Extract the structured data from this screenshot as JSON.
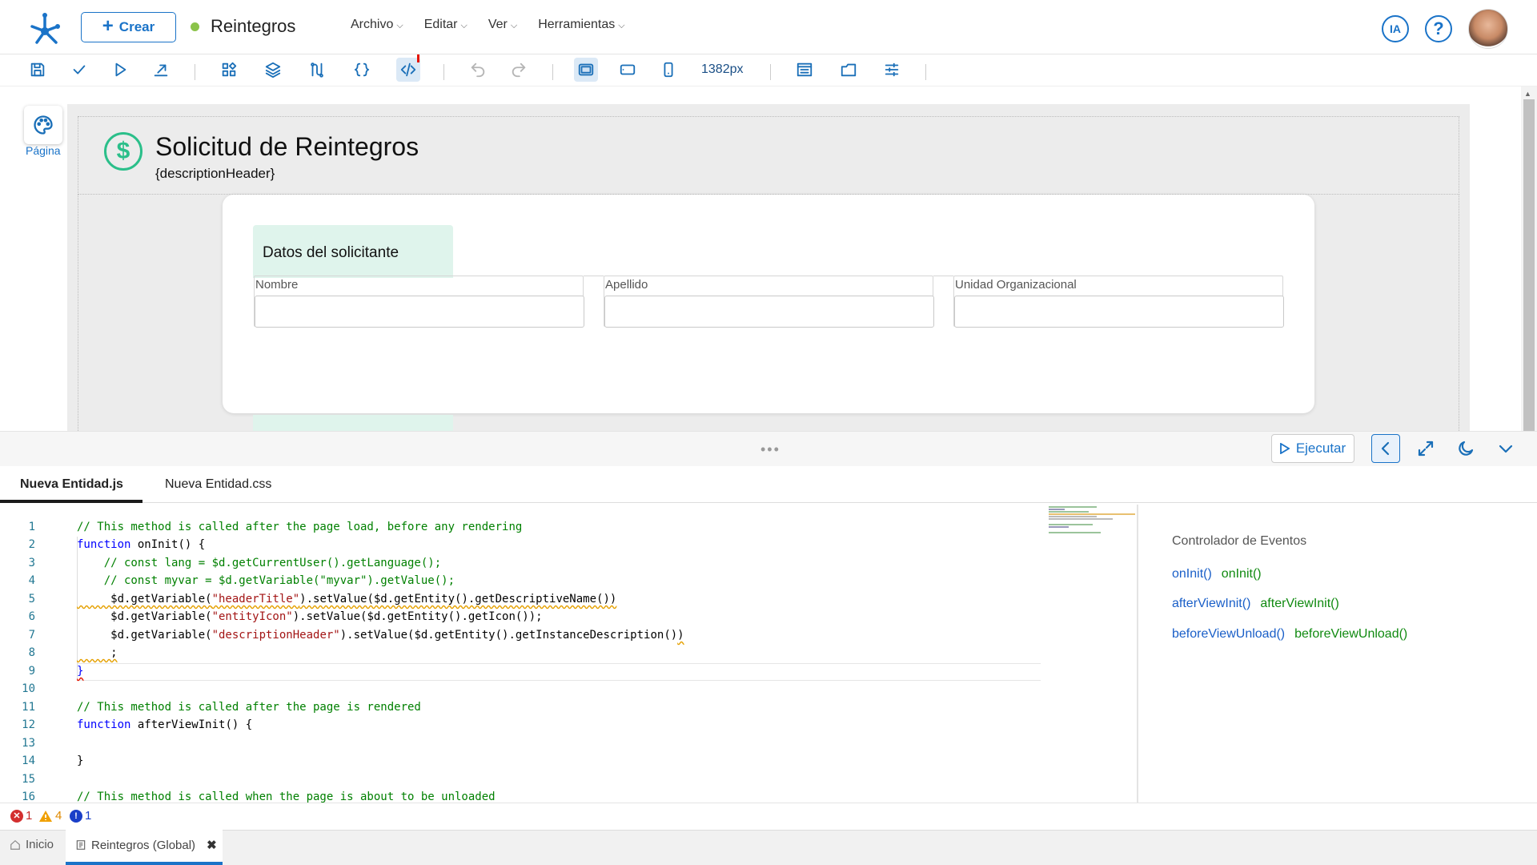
{
  "topbar": {
    "create_label": "Crear",
    "app_title": "Reintegros",
    "menu": [
      "Archivo",
      "Editar",
      "Ver",
      "Herramientas"
    ],
    "ia_label": "IA",
    "help_label": "?"
  },
  "toolbar": {
    "width_readout": "1382px"
  },
  "sidebar": {
    "page_label": "Página"
  },
  "form": {
    "title": "Solicitud de Reintegros",
    "description": "{descriptionHeader}",
    "section_title": "Datos del solicitante",
    "fields": [
      {
        "label": "Nombre",
        "value": ""
      },
      {
        "label": "Apellido",
        "value": ""
      },
      {
        "label": "Unidad Organizacional",
        "value": ""
      }
    ]
  },
  "editor": {
    "run_label": "Ejecutar",
    "drag_handle": "•••",
    "tabs": [
      "Nueva Entidad.js",
      "Nueva Entidad.css"
    ],
    "line_numbers": [
      "1",
      "2",
      "3",
      "4",
      "5",
      "6",
      "7",
      "8",
      "9",
      "10",
      "11",
      "12",
      "13",
      "14",
      "15",
      "16"
    ]
  },
  "events": {
    "title": "Controlador de Eventos",
    "items": [
      {
        "name": "onInit()",
        "handler": "onInit()"
      },
      {
        "name": "afterViewInit()",
        "handler": "afterViewInit()"
      },
      {
        "name": "beforeViewUnload()",
        "handler": "beforeViewUnload()"
      }
    ]
  },
  "problems": {
    "errors": "1",
    "warnings": "4",
    "infos": "1"
  },
  "bottom_tabs": {
    "home": "Inicio",
    "current": "Reintegros (Global)"
  },
  "colors": {
    "accent": "#1a73c8",
    "status_green": "#8bc34a",
    "brand_teal": "#2bbf8a"
  }
}
